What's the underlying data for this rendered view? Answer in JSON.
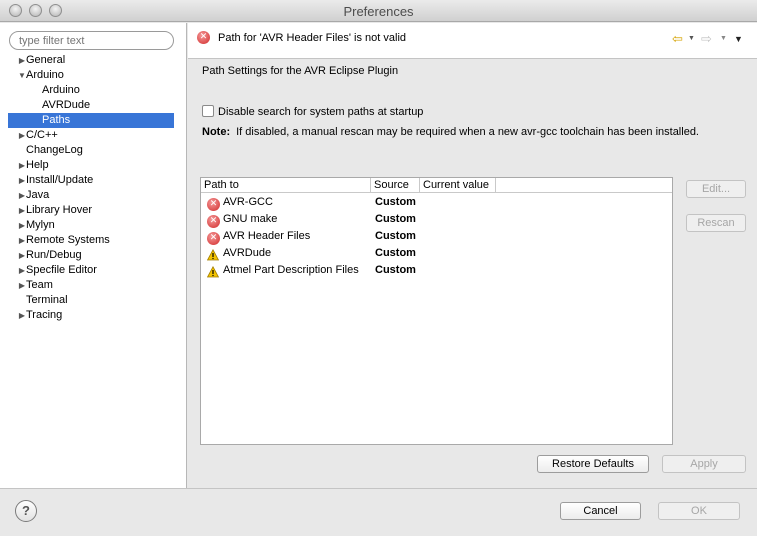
{
  "window": {
    "title": "Preferences"
  },
  "filter": {
    "placeholder": "type filter text"
  },
  "tree": [
    {
      "label": "General",
      "depth": 0,
      "expander": "right"
    },
    {
      "label": "Arduino",
      "depth": 0,
      "expander": "down"
    },
    {
      "label": "Arduino",
      "depth": 2,
      "expander": ""
    },
    {
      "label": "AVRDude",
      "depth": 2,
      "expander": ""
    },
    {
      "label": "Paths",
      "depth": 2,
      "expander": "",
      "selected": true
    },
    {
      "label": "C/C++",
      "depth": 0,
      "expander": "right"
    },
    {
      "label": "ChangeLog",
      "depth": 1,
      "expander": ""
    },
    {
      "label": "Help",
      "depth": 0,
      "expander": "right"
    },
    {
      "label": "Install/Update",
      "depth": 0,
      "expander": "right"
    },
    {
      "label": "Java",
      "depth": 0,
      "expander": "right"
    },
    {
      "label": "Library Hover",
      "depth": 0,
      "expander": "right"
    },
    {
      "label": "Mylyn",
      "depth": 0,
      "expander": "right"
    },
    {
      "label": "Remote Systems",
      "depth": 0,
      "expander": "right"
    },
    {
      "label": "Run/Debug",
      "depth": 0,
      "expander": "right"
    },
    {
      "label": "Specfile Editor",
      "depth": 0,
      "expander": "right"
    },
    {
      "label": "Team",
      "depth": 0,
      "expander": "right"
    },
    {
      "label": "Terminal",
      "depth": 1,
      "expander": ""
    },
    {
      "label": "Tracing",
      "depth": 0,
      "expander": "right"
    }
  ],
  "message": {
    "text": "Path for 'AVR Header Files' is not valid",
    "icon": "error-icon"
  },
  "page": {
    "description": "Path Settings for the AVR Eclipse Plugin",
    "checkbox_label": "Disable search for system paths at startup",
    "checkbox_checked": false,
    "note_label": "Note:",
    "note_text": "If disabled, a manual rescan may be required when a new avr-gcc toolchain has been installed."
  },
  "table": {
    "headers": [
      "Path to",
      "Source",
      "Current value"
    ],
    "rows": [
      {
        "status": "error",
        "name": "AVR-GCC",
        "source": "Custom",
        "value": ""
      },
      {
        "status": "error",
        "name": "GNU make",
        "source": "Custom",
        "value": ""
      },
      {
        "status": "error",
        "name": "AVR Header Files",
        "source": "Custom",
        "value": ""
      },
      {
        "status": "warning",
        "name": "AVRDude",
        "source": "Custom",
        "value": ""
      },
      {
        "status": "warning",
        "name": "Atmel Part Description Files",
        "source": "Custom",
        "value": ""
      }
    ]
  },
  "buttons": {
    "edit": "Edit...",
    "rescan": "Rescan",
    "restore_defaults": "Restore Defaults",
    "apply": "Apply",
    "cancel": "Cancel",
    "ok": "OK",
    "help": "?"
  },
  "colors": {
    "selection": "#3875d7",
    "error": "#d12a2a",
    "warning": "#e8b800"
  }
}
